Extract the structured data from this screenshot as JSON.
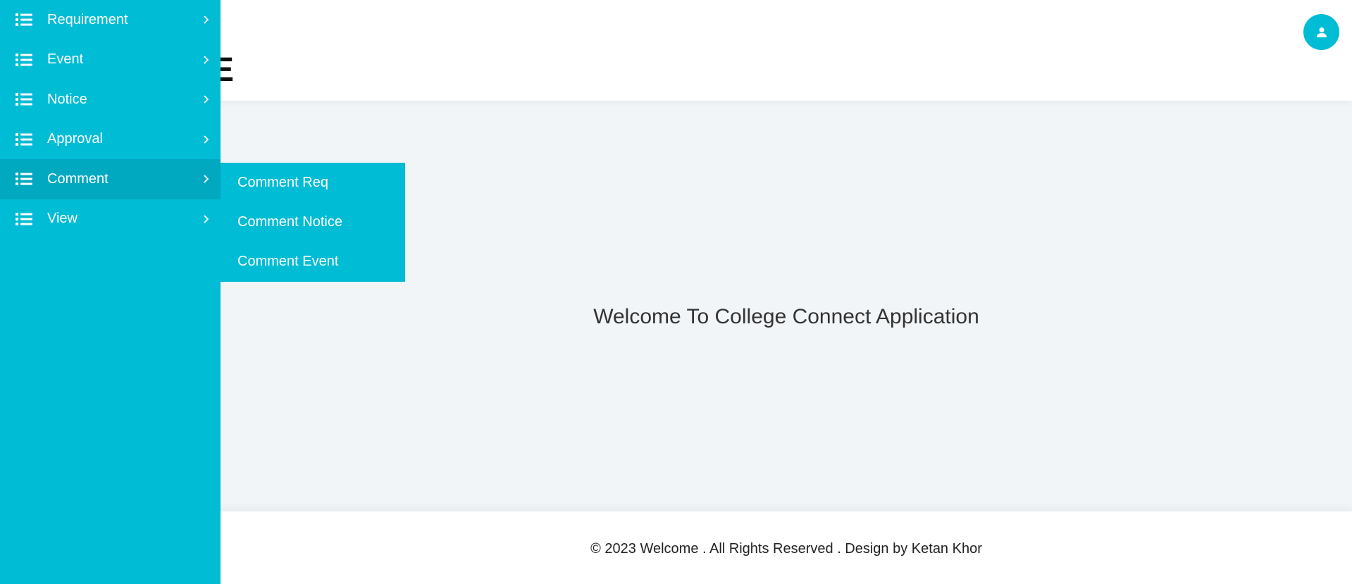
{
  "header": {
    "brand_fragment": "E",
    "user_icon": "user-icon"
  },
  "sidebar": {
    "items": [
      {
        "label": "Requirement",
        "icon": "list-icon"
      },
      {
        "label": "Event",
        "icon": "list-icon"
      },
      {
        "label": "Notice",
        "icon": "list-icon"
      },
      {
        "label": "Approval",
        "icon": "list-icon"
      },
      {
        "label": "Comment",
        "icon": "list-icon",
        "active": true
      },
      {
        "label": "View",
        "icon": "list-icon"
      }
    ],
    "submenu": {
      "parent": "Comment",
      "items": [
        {
          "label": "Comment Req"
        },
        {
          "label": "Comment Notice"
        },
        {
          "label": "Comment Event"
        }
      ]
    }
  },
  "main": {
    "welcome": "Welcome To College Connect Application"
  },
  "footer": {
    "text": "© 2023 Welcome . All Rights Reserved . Design by Ketan Khor"
  },
  "colors": {
    "accent": "#00bcd4",
    "accent_active": "#00a8c0",
    "background": "#f2f5f8"
  }
}
